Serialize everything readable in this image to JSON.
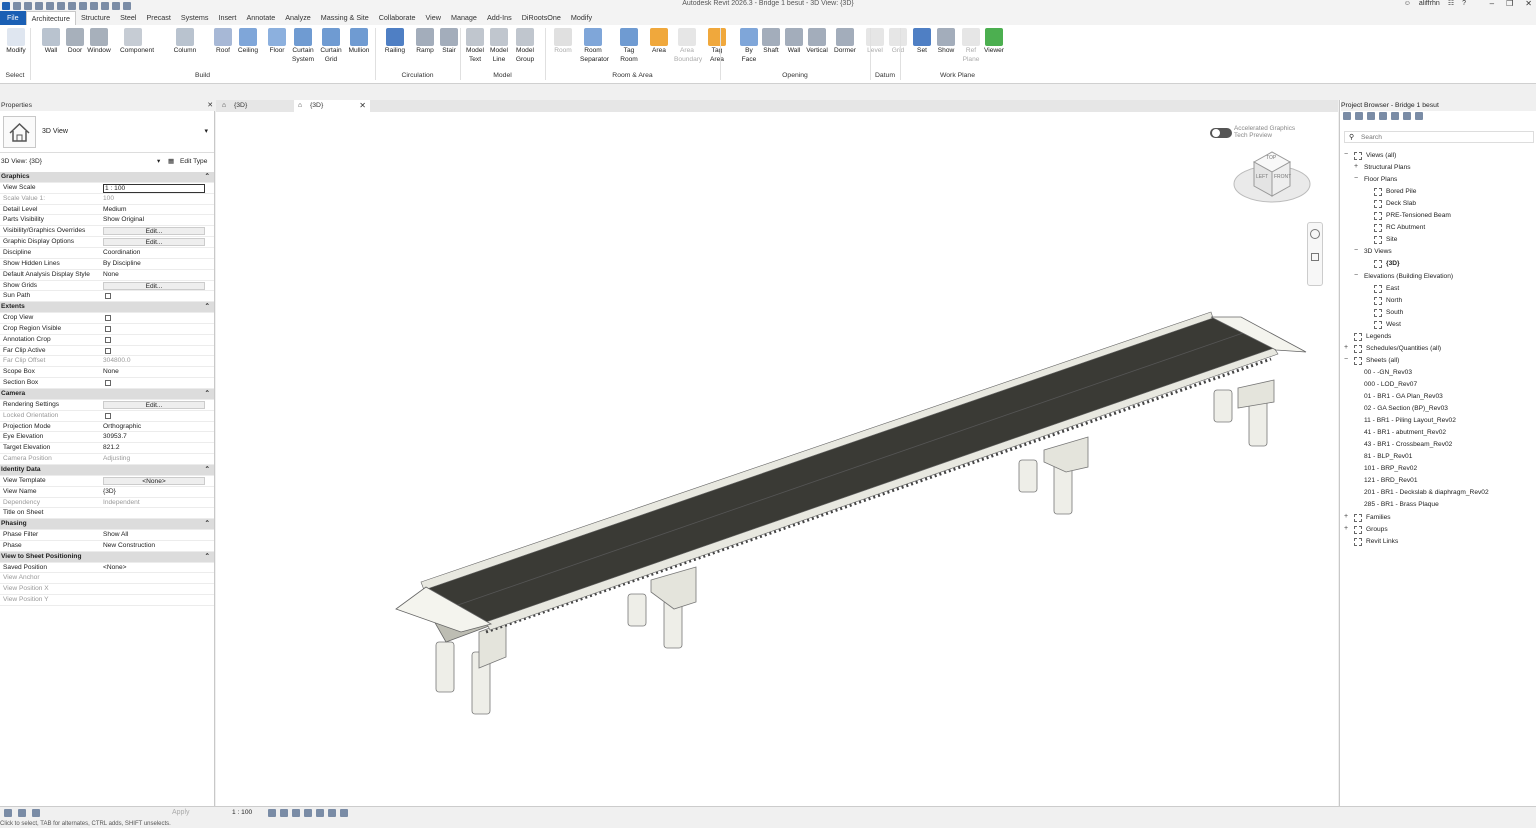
{
  "title": "Autodesk Revit 2026.3 - Bridge 1 besut - 3D View: {3D}",
  "user": "aliffrhn",
  "tabs": [
    "File",
    "Architecture",
    "Structure",
    "Steel",
    "Precast",
    "Systems",
    "Insert",
    "Annotate",
    "Analyze",
    "Massing & Site",
    "Collaborate",
    "View",
    "Manage",
    "Add-Ins",
    "DiRootsOne",
    "Modify"
  ],
  "ribbon": {
    "buttons": [
      {
        "l1": "Modify",
        "l2": ""
      },
      {
        "l1": "Wall",
        "l2": ""
      },
      {
        "l1": "Door",
        "l2": ""
      },
      {
        "l1": "Window",
        "l2": ""
      },
      {
        "l1": "Component",
        "l2": ""
      },
      {
        "l1": "Column",
        "l2": ""
      },
      {
        "l1": "Roof",
        "l2": ""
      },
      {
        "l1": "Ceiling",
        "l2": ""
      },
      {
        "l1": "Floor",
        "l2": ""
      },
      {
        "l1": "Curtain",
        "l2": "System"
      },
      {
        "l1": "Curtain",
        "l2": "Grid"
      },
      {
        "l1": "Mullion",
        "l2": ""
      },
      {
        "l1": "Railing",
        "l2": ""
      },
      {
        "l1": "Ramp",
        "l2": ""
      },
      {
        "l1": "Stair",
        "l2": ""
      },
      {
        "l1": "Model",
        "l2": "Text"
      },
      {
        "l1": "Model",
        "l2": "Line"
      },
      {
        "l1": "Model",
        "l2": "Group"
      },
      {
        "l1": "Room",
        "l2": ""
      },
      {
        "l1": "Room",
        "l2": "Separator"
      },
      {
        "l1": "Tag",
        "l2": "Room"
      },
      {
        "l1": "Area",
        "l2": ""
      },
      {
        "l1": "Area",
        "l2": "Boundary"
      },
      {
        "l1": "Tag",
        "l2": "Area"
      },
      {
        "l1": "By",
        "l2": "Face"
      },
      {
        "l1": "Shaft",
        "l2": ""
      },
      {
        "l1": "Wall",
        "l2": ""
      },
      {
        "l1": "Vertical",
        "l2": ""
      },
      {
        "l1": "Dormer",
        "l2": ""
      },
      {
        "l1": "Level",
        "l2": ""
      },
      {
        "l1": "Grid",
        "l2": ""
      },
      {
        "l1": "Set",
        "l2": ""
      },
      {
        "l1": "Show",
        "l2": ""
      },
      {
        "l1": "Ref",
        "l2": "Plane"
      },
      {
        "l1": "Viewer",
        "l2": ""
      }
    ],
    "groups": [
      "Select",
      "Build",
      "Circulation",
      "Model",
      "Room & Area",
      "Opening",
      "Datum",
      "Work Plane"
    ]
  },
  "properties": {
    "header": "Properties",
    "type_name": "3D View",
    "instance_selector": "3D View: {3D}",
    "edit_type": "Edit Type",
    "rows": [
      {
        "k": "cat",
        "n": "Graphics"
      },
      {
        "n": "View Scale",
        "v": "1 : 100",
        "box": true
      },
      {
        "n": "Scale Value    1:",
        "v": "100",
        "gray": true
      },
      {
        "n": "Detail Level",
        "v": "Medium"
      },
      {
        "n": "Parts Visibility",
        "v": "Show Original"
      },
      {
        "n": "Visibility/Graphics Overrides",
        "v": "Edit...",
        "btn": true
      },
      {
        "n": "Graphic Display Options",
        "v": "Edit...",
        "btn": true
      },
      {
        "n": "Discipline",
        "v": "Coordination"
      },
      {
        "n": "Show Hidden Lines",
        "v": "By Discipline"
      },
      {
        "n": "Default Analysis Display Style",
        "v": "None"
      },
      {
        "n": "Show Grids",
        "v": "Edit...",
        "btn": true
      },
      {
        "n": "Sun Path",
        "chk": true
      },
      {
        "k": "cat",
        "n": "Extents"
      },
      {
        "n": "Crop View",
        "chk": true
      },
      {
        "n": "Crop Region Visible",
        "chk": true
      },
      {
        "n": "Annotation Crop",
        "chk": true
      },
      {
        "n": "Far Clip Active",
        "chk": true
      },
      {
        "n": "Far Clip Offset",
        "v": "304800.0",
        "gray": true
      },
      {
        "n": "Scope Box",
        "v": "None"
      },
      {
        "n": "Section Box",
        "chk": true
      },
      {
        "k": "cat",
        "n": "Camera"
      },
      {
        "n": "Rendering Settings",
        "v": "Edit...",
        "btn": true
      },
      {
        "n": "Locked Orientation",
        "chk": true,
        "gray": true
      },
      {
        "n": "Projection Mode",
        "v": "Orthographic"
      },
      {
        "n": "Eye Elevation",
        "v": "30953.7"
      },
      {
        "n": "Target Elevation",
        "v": "821.2"
      },
      {
        "n": "Camera Position",
        "v": "Adjusting",
        "gray": true
      },
      {
        "k": "cat",
        "n": "Identity Data"
      },
      {
        "n": "View Template",
        "v": "<None>",
        "btn": true
      },
      {
        "n": "View Name",
        "v": "{3D}"
      },
      {
        "n": "Dependency",
        "v": "Independent",
        "gray": true
      },
      {
        "n": "Title on Sheet",
        "v": ""
      },
      {
        "k": "cat",
        "n": "Phasing"
      },
      {
        "n": "Phase Filter",
        "v": "Show All"
      },
      {
        "n": "Phase",
        "v": "New Construction"
      },
      {
        "k": "cat",
        "n": "View to Sheet Positioning"
      },
      {
        "n": "Saved Position",
        "v": "<None>"
      },
      {
        "n": "View Anchor",
        "v": "",
        "gray": true
      },
      {
        "n": "View Position X",
        "v": "",
        "gray": true
      },
      {
        "n": "View Position Y",
        "v": "",
        "gray": true
      }
    ],
    "apply": "Apply"
  },
  "view_tabs": [
    "{3D}",
    "{3D}"
  ],
  "viewport": {
    "accel_label1": "Accelerated Graphics",
    "accel_label2": "Tech Preview",
    "cube_top": "TOP",
    "cube_left": "LEFT",
    "cube_front": "FRONT"
  },
  "status": {
    "scale": "1 : 100",
    "hint": "Click to select, TAB for alternates, CTRL adds, SHIFT unselects."
  },
  "browser": {
    "header": "Project Browser - Bridge 1 besut",
    "search_placeholder": "Search",
    "items": [
      {
        "t": "Views (all)",
        "lvl": 0,
        "tog": "−",
        "icon": true
      },
      {
        "t": "Structural Plans",
        "lvl": 1,
        "tog": "+"
      },
      {
        "t": "Floor Plans",
        "lvl": 1,
        "tog": "−"
      },
      {
        "t": "Bored Pile",
        "lvl": 2,
        "icon": true
      },
      {
        "t": "Deck Slab",
        "lvl": 2,
        "icon": true
      },
      {
        "t": "PRE-Tensioned Beam",
        "lvl": 2,
        "icon": true
      },
      {
        "t": "RC Abutment",
        "lvl": 2,
        "icon": true
      },
      {
        "t": "Site",
        "lvl": 2,
        "icon": true
      },
      {
        "t": "3D Views",
        "lvl": 1,
        "tog": "−"
      },
      {
        "t": "{3D}",
        "lvl": 2,
        "icon": true,
        "bold": true
      },
      {
        "t": "Elevations (Building Elevation)",
        "lvl": 1,
        "tog": "−"
      },
      {
        "t": "East",
        "lvl": 2,
        "icon": true
      },
      {
        "t": "North",
        "lvl": 2,
        "icon": true
      },
      {
        "t": "South",
        "lvl": 2,
        "icon": true
      },
      {
        "t": "West",
        "lvl": 2,
        "icon": true
      },
      {
        "t": "Legends",
        "lvl": 0,
        "icon": true
      },
      {
        "t": "Schedules/Quantities (all)",
        "lvl": 0,
        "tog": "+",
        "icon": true
      },
      {
        "t": "Sheets (all)",
        "lvl": 0,
        "tog": "−",
        "icon": true
      },
      {
        "t": "00 - -GN_Rev03",
        "lvl": 1
      },
      {
        "t": "000 - LOD_Rev07",
        "lvl": 1
      },
      {
        "t": "01 - BR1 - GA Plan_Rev03",
        "lvl": 1
      },
      {
        "t": "02 - GA Section (BP)_Rev03",
        "lvl": 1
      },
      {
        "t": "11 - BR1 - Piling Layout_Rev02",
        "lvl": 1
      },
      {
        "t": "41 - BR1 - abutment_Rev02",
        "lvl": 1
      },
      {
        "t": "43 - BR1 - Crossbeam_Rev02",
        "lvl": 1
      },
      {
        "t": "81 - BLP_Rev01",
        "lvl": 1
      },
      {
        "t": "101 - BRP_Rev02",
        "lvl": 1
      },
      {
        "t": "121 - BRD_Rev01",
        "lvl": 1
      },
      {
        "t": "201 - BR1 - Deckslab & diaphragm_Rev02",
        "lvl": 1
      },
      {
        "t": "285 - BR1 - Brass Plaque",
        "lvl": 1
      },
      {
        "t": "Families",
        "lvl": 0,
        "tog": "+",
        "icon": true
      },
      {
        "t": "Groups",
        "lvl": 0,
        "tog": "+",
        "icon": true
      },
      {
        "t": "Revit Links",
        "lvl": 0,
        "icon": true
      }
    ]
  }
}
